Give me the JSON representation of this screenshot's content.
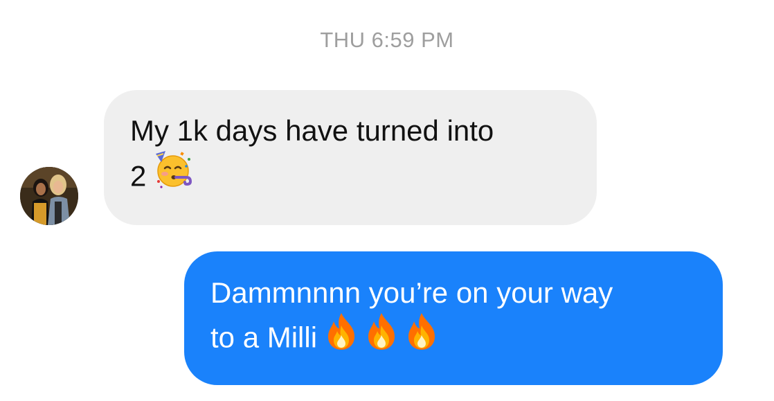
{
  "conversation": {
    "timestamp": "THU 6:59 PM",
    "messages": [
      {
        "direction": "incoming",
        "lines": [
          "My 1k days have turned into",
          "2"
        ],
        "emoji": [
          "partying-face"
        ]
      },
      {
        "direction": "outgoing",
        "lines": [
          "Dammnnnn you’re on your way",
          "to a Milli"
        ],
        "emoji": [
          "fire",
          "fire",
          "fire"
        ]
      }
    ]
  },
  "colors": {
    "incoming_bubble": "#efefef",
    "outgoing_bubble": "#1a82fb",
    "timestamp_text": "#9e9e9e"
  }
}
